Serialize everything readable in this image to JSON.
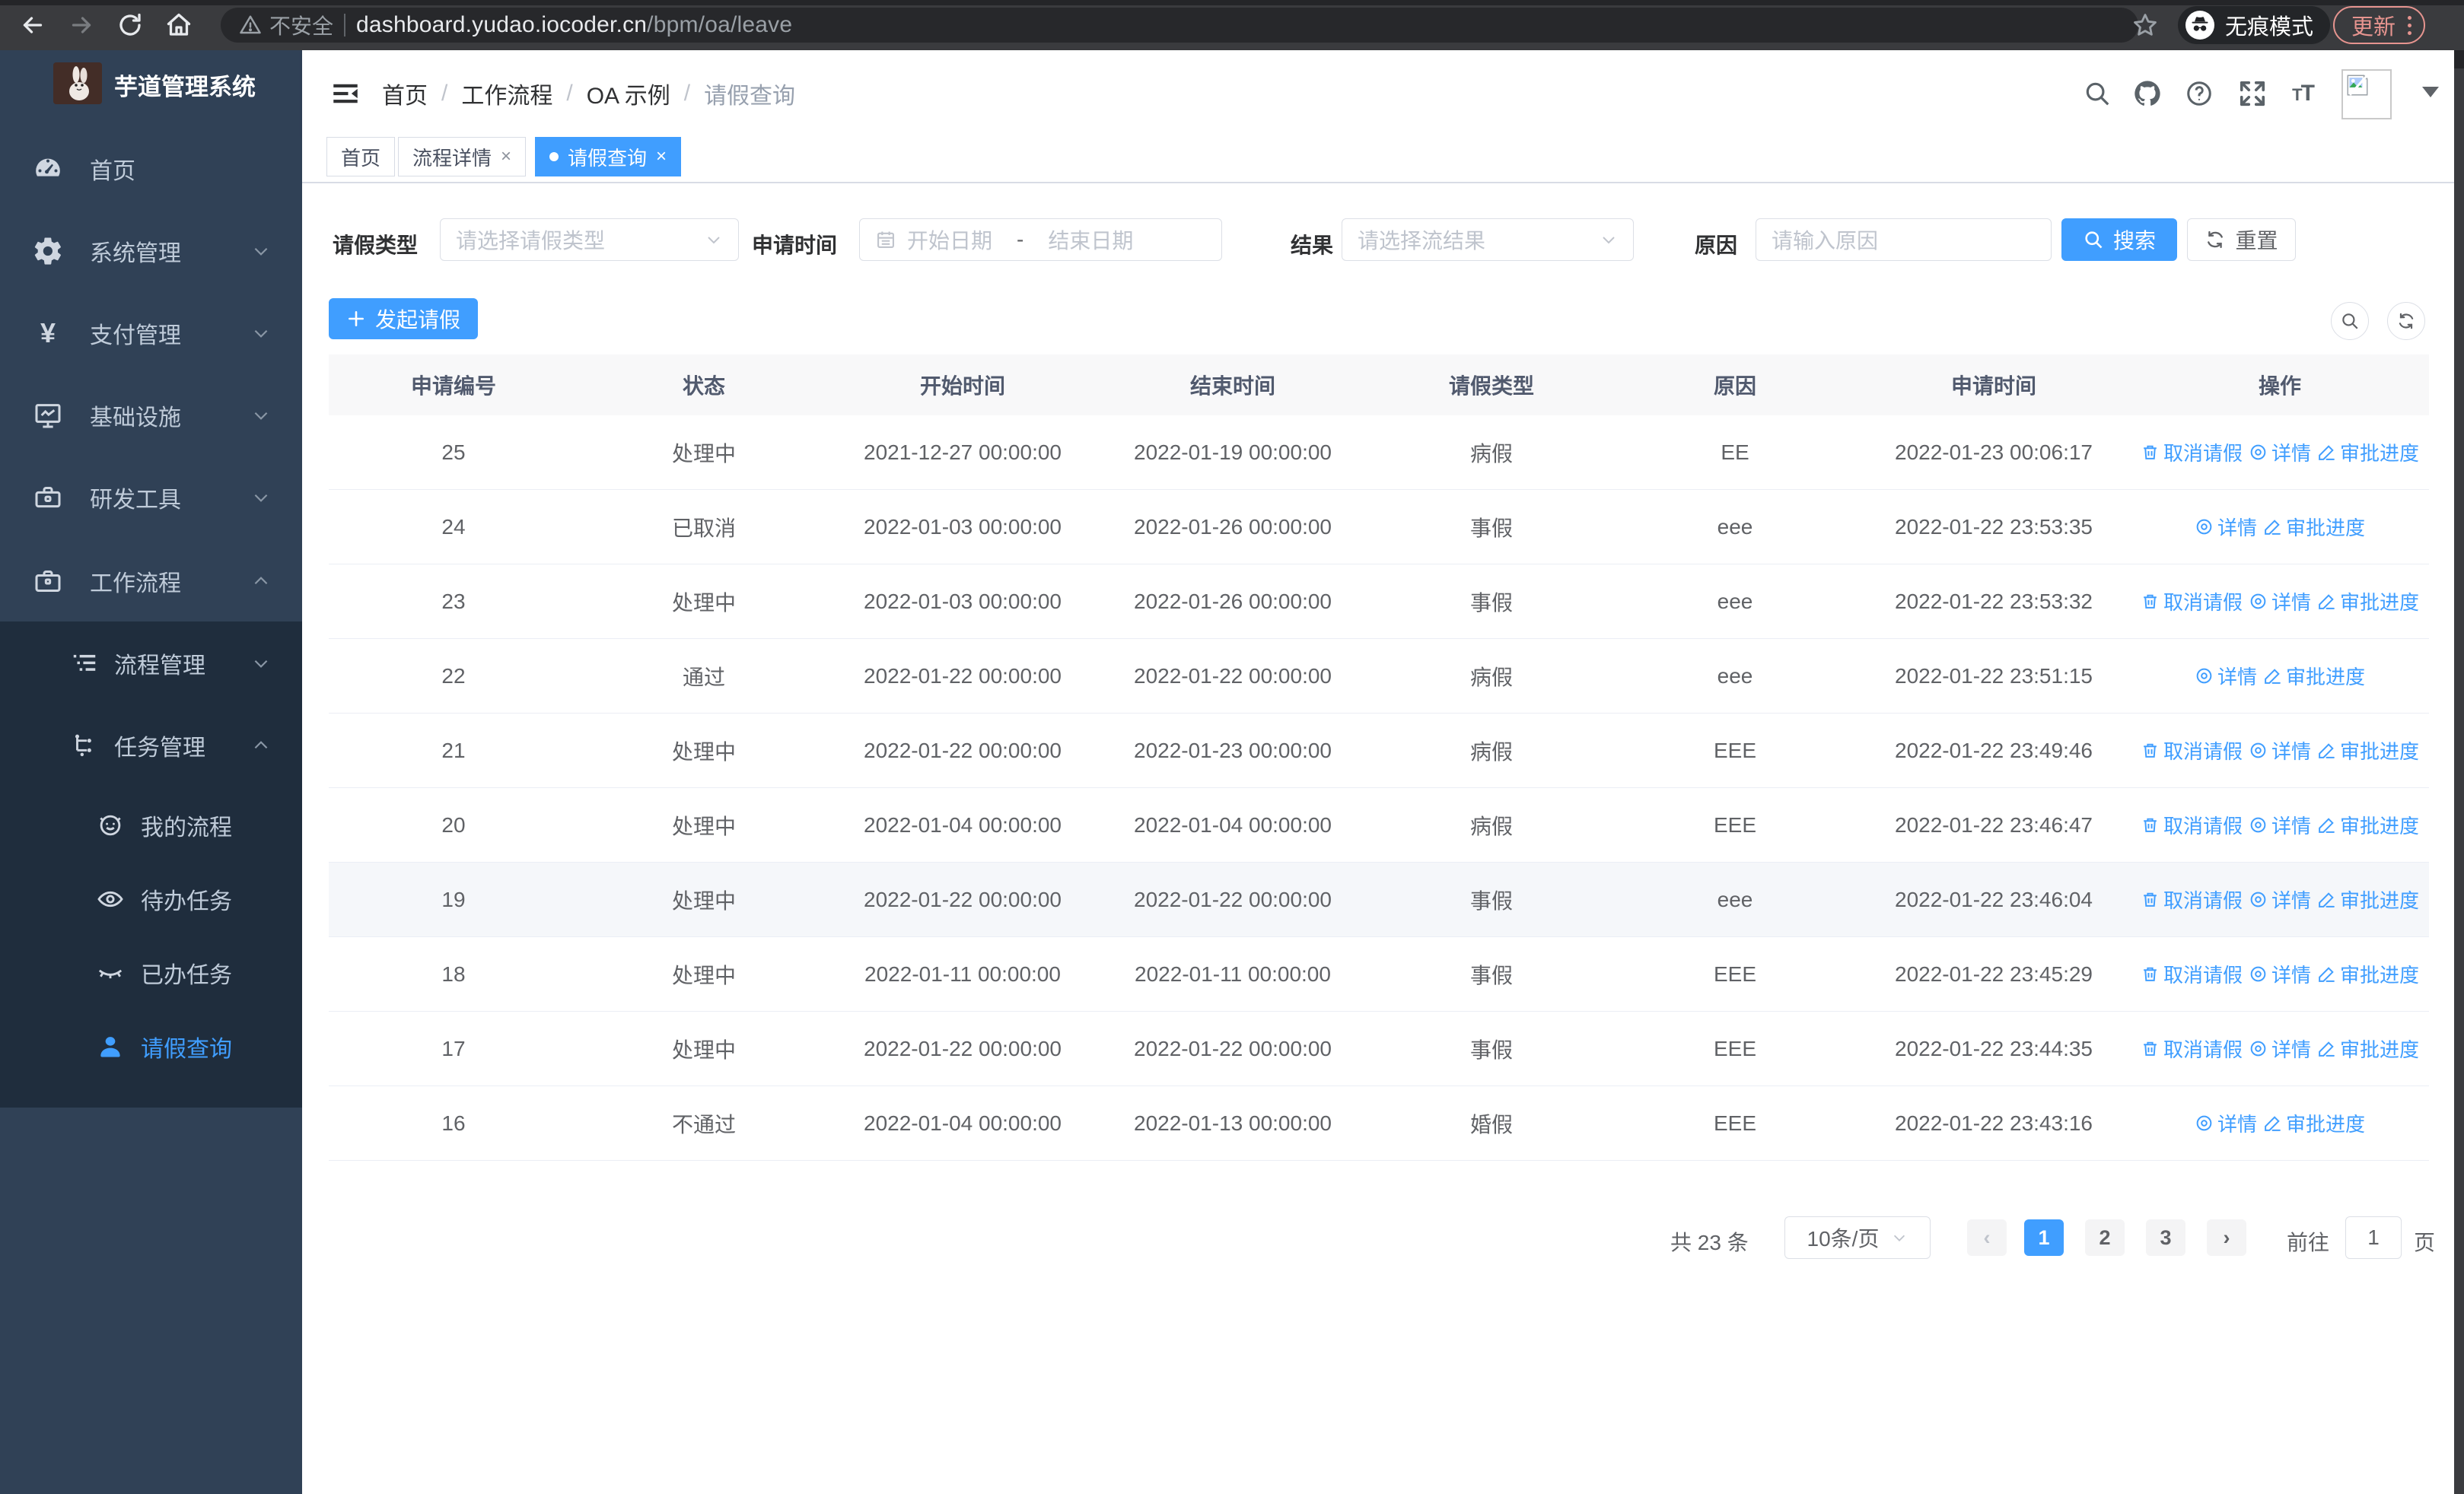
{
  "colors": {
    "accent": "#409eff",
    "sidebar_bg": "#304156",
    "submenu_bg": "#1f2d3d",
    "sidebar_text": "#bfcbd9",
    "update_button": "#e6948f",
    "table_header_bg": "#f8f8f9"
  },
  "browser": {
    "security_label": "不安全",
    "url_host": "dashboard.yudao.iocoder.cn",
    "url_path": "/bpm/oa/leave",
    "incognito_label": "无痕模式",
    "update_label": "更新",
    "icons": [
      "back-icon",
      "forward-icon",
      "reload-icon",
      "home-icon",
      "warning-icon",
      "bookmark-star-icon",
      "incognito-icon",
      "menu-dots-icon"
    ]
  },
  "sidebar": {
    "title": "芋道管理系统",
    "logo_icon": "rabbit-logo",
    "items": [
      {
        "label": "首页",
        "icon": "dashboard-icon"
      },
      {
        "label": "系统管理",
        "icon": "gear-icon",
        "chevron": "down"
      },
      {
        "label": "支付管理",
        "icon": "yuan-icon",
        "chevron": "down"
      },
      {
        "label": "基础设施",
        "icon": "monitor-icon",
        "chevron": "down"
      },
      {
        "label": "研发工具",
        "icon": "toolbox-icon",
        "chevron": "down"
      },
      {
        "label": "工作流程",
        "icon": "briefcase-icon",
        "chevron": "up"
      }
    ],
    "submenu": [
      {
        "label": "流程管理",
        "icon": "list-icon",
        "chevron": "down"
      },
      {
        "label": "任务管理",
        "icon": "flow-icon",
        "chevron": "up"
      }
    ],
    "task_items": [
      {
        "label": "我的流程",
        "icon": "face-icon"
      },
      {
        "label": "待办任务",
        "icon": "eye-open-icon"
      },
      {
        "label": "已办任务",
        "icon": "eye-closed-icon"
      },
      {
        "label": "请假查询",
        "icon": "user-icon",
        "active": true
      }
    ]
  },
  "header": {
    "breadcrumb": [
      "首页",
      "工作流程",
      "OA 示例",
      "请假查询"
    ],
    "separator": "/",
    "icons": [
      "collapse-sidebar-icon",
      "search-icon",
      "github-icon",
      "help-icon",
      "fullscreen-icon",
      "font-size-icon",
      "avatar-broken-image",
      "chevron-down-icon"
    ],
    "font_size_glyph_small": "T",
    "font_size_glyph_big": "T"
  },
  "tabs": [
    {
      "label": "首页",
      "closable": false,
      "active": false
    },
    {
      "label": "流程详情",
      "closable": true,
      "active": false
    },
    {
      "label": "请假查询",
      "closable": true,
      "active": true
    }
  ],
  "tab_close_glyph": "×",
  "filters": {
    "leave_type_label": "请假类型",
    "leave_type_placeholder": "请选择请假类型",
    "apply_time_label": "申请时间",
    "date_start_placeholder": "开始日期",
    "date_separator": "-",
    "date_end_placeholder": "结束日期",
    "result_label": "结果",
    "result_placeholder": "请选择流结果",
    "reason_label": "原因",
    "reason_placeholder": "请输入原因",
    "search_label": "搜索",
    "reset_label": "重置"
  },
  "toolbar": {
    "create_label": "发起请假",
    "icons": [
      "plus-icon",
      "search-circle-icon",
      "refresh-circle-icon"
    ]
  },
  "table": {
    "columns": [
      "申请编号",
      "状态",
      "开始时间",
      "结束时间",
      "请假类型",
      "原因",
      "申请时间",
      "操作"
    ],
    "action_labels": {
      "cancel": "取消请假",
      "detail": "详情",
      "progress": "审批进度"
    },
    "action_icons": [
      "trash-icon",
      "eye-icon",
      "pen-icon"
    ],
    "rows": [
      {
        "id": "25",
        "status": "处理中",
        "start": "2021-12-27 00:00:00",
        "end": "2022-01-19 00:00:00",
        "type": "病假",
        "reason": "EE",
        "apply_time": "2022-01-23 00:06:17",
        "cancellable": true,
        "highlight": false
      },
      {
        "id": "24",
        "status": "已取消",
        "start": "2022-01-03 00:00:00",
        "end": "2022-01-26 00:00:00",
        "type": "事假",
        "reason": "eee",
        "apply_time": "2022-01-22 23:53:35",
        "cancellable": false,
        "highlight": false
      },
      {
        "id": "23",
        "status": "处理中",
        "start": "2022-01-03 00:00:00",
        "end": "2022-01-26 00:00:00",
        "type": "事假",
        "reason": "eee",
        "apply_time": "2022-01-22 23:53:32",
        "cancellable": true,
        "highlight": false
      },
      {
        "id": "22",
        "status": "通过",
        "start": "2022-01-22 00:00:00",
        "end": "2022-01-22 00:00:00",
        "type": "病假",
        "reason": "eee",
        "apply_time": "2022-01-22 23:51:15",
        "cancellable": false,
        "highlight": false
      },
      {
        "id": "21",
        "status": "处理中",
        "start": "2022-01-22 00:00:00",
        "end": "2022-01-23 00:00:00",
        "type": "病假",
        "reason": "EEE",
        "apply_time": "2022-01-22 23:49:46",
        "cancellable": true,
        "highlight": false
      },
      {
        "id": "20",
        "status": "处理中",
        "start": "2022-01-04 00:00:00",
        "end": "2022-01-04 00:00:00",
        "type": "病假",
        "reason": "EEE",
        "apply_time": "2022-01-22 23:46:47",
        "cancellable": true,
        "highlight": false
      },
      {
        "id": "19",
        "status": "处理中",
        "start": "2022-01-22 00:00:00",
        "end": "2022-01-22 00:00:00",
        "type": "事假",
        "reason": "eee",
        "apply_time": "2022-01-22 23:46:04",
        "cancellable": true,
        "highlight": true
      },
      {
        "id": "18",
        "status": "处理中",
        "start": "2022-01-11 00:00:00",
        "end": "2022-01-11 00:00:00",
        "type": "事假",
        "reason": "EEE",
        "apply_time": "2022-01-22 23:45:29",
        "cancellable": true,
        "highlight": false
      },
      {
        "id": "17",
        "status": "处理中",
        "start": "2022-01-22 00:00:00",
        "end": "2022-01-22 00:00:00",
        "type": "事假",
        "reason": "EEE",
        "apply_time": "2022-01-22 23:44:35",
        "cancellable": true,
        "highlight": false
      },
      {
        "id": "16",
        "status": "不通过",
        "start": "2022-01-04 00:00:00",
        "end": "2022-01-13 00:00:00",
        "type": "婚假",
        "reason": "EEE",
        "apply_time": "2022-01-22 23:43:16",
        "cancellable": false,
        "highlight": false
      }
    ]
  },
  "pagination": {
    "total_label": "共 23 条",
    "page_size_label": "10条/页",
    "pages": [
      "1",
      "2",
      "3"
    ],
    "active_page": "1",
    "prev_glyph": "‹",
    "next_glyph": "›",
    "goto_label": "前往",
    "goto_value": "1",
    "unit_label": "页"
  }
}
